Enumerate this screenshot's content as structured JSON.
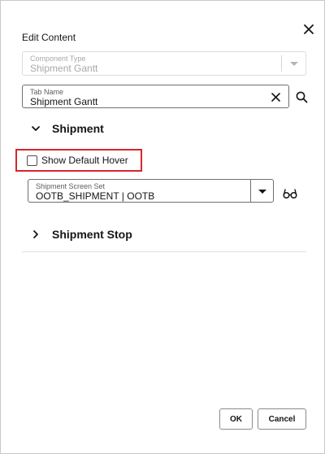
{
  "dialog": {
    "title": "Edit Content",
    "close_icon": "close-icon"
  },
  "component_type": {
    "label": "Component Type",
    "value": "Shipment Gantt",
    "disabled": true
  },
  "tab_name": {
    "label": "Tab Name",
    "value": "Shipment Gantt",
    "clear_icon": "clear-icon",
    "search_icon": "search-icon"
  },
  "shipment_section": {
    "title": "Shipment",
    "expanded": true,
    "show_default_hover": {
      "label": "Show Default Hover",
      "checked": false
    },
    "screen_set": {
      "label": "Shipment Screen Set",
      "value": "OOTB_SHIPMENT | OOTB",
      "view_icon": "glasses-icon"
    }
  },
  "shipment_stop_section": {
    "title": "Shipment Stop",
    "expanded": false
  },
  "footer": {
    "ok_label": "OK",
    "cancel_label": "Cancel"
  },
  "colors": {
    "highlight": "#d9252d",
    "text": "#161513"
  }
}
